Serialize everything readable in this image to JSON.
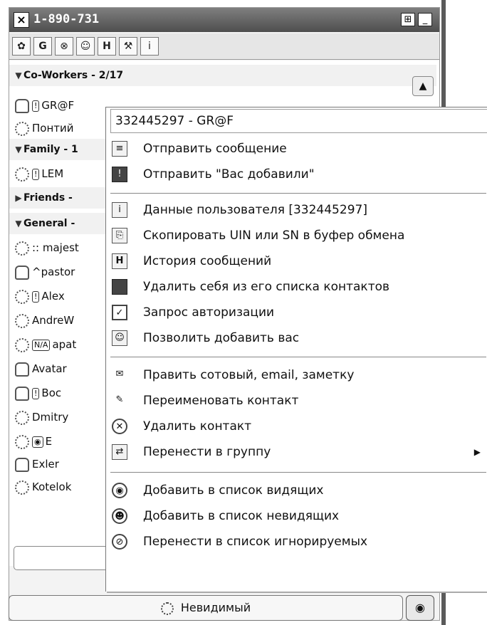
{
  "titlebar": {
    "title": "1-890-731"
  },
  "groups": [
    {
      "label": "Co-Workers - 2/17"
    },
    {
      "label": "Family - 1"
    },
    {
      "label": "Friends -"
    },
    {
      "label": "General -"
    }
  ],
  "contacts": [
    {
      "name": "GR@F"
    },
    {
      "name": "Понтий"
    },
    {
      "name": "LEM"
    },
    {
      "name": ":: majest"
    },
    {
      "name": "^pastor"
    },
    {
      "name": "Alex"
    },
    {
      "name": "AndreW"
    },
    {
      "name": "apat"
    },
    {
      "name": "Avatar"
    },
    {
      "name": "Boc"
    },
    {
      "name": "Dmitry"
    },
    {
      "name": "E"
    },
    {
      "name": "Exler"
    },
    {
      "name": "Kotelok"
    }
  ],
  "menu": {
    "header": "332445297 - GR@F",
    "items": [
      {
        "label": "Отправить сообщение",
        "icon": "message-icon"
      },
      {
        "label": "Отправить \"Вас добавили\"",
        "icon": "added-notice-icon"
      },
      {
        "label": "Данные пользователя [332445297]",
        "icon": "user-info-icon"
      },
      {
        "label": "Скопировать UIN или SN в буфер обмена",
        "icon": "copy-icon"
      },
      {
        "label": "История сообщений",
        "icon": "history-icon"
      },
      {
        "label": "Удалить себя из его списка контактов",
        "icon": "remove-self-icon"
      },
      {
        "label": "Запрос авторизации",
        "icon": "authorization-icon"
      },
      {
        "label": "Позволить добавить вас",
        "icon": "allow-add-icon"
      },
      {
        "label": "Править сотовый, email, заметку",
        "icon": "edit-contact-info-icon"
      },
      {
        "label": "Переименовать контакт",
        "icon": "rename-icon"
      },
      {
        "label": "Удалить контакт",
        "icon": "delete-contact-icon"
      },
      {
        "label": "Перенести в группу",
        "icon": "move-group-icon",
        "submenu": true
      },
      {
        "label": "Добавить в список видящих",
        "icon": "visible-list-icon"
      },
      {
        "label": "Добавить в список невидящих",
        "icon": "invisible-list-icon"
      },
      {
        "label": "Перенести в список игнорируемых",
        "icon": "ignore-list-icon"
      }
    ]
  },
  "status": {
    "label": "Невидимый"
  },
  "icons": {
    "toolbar": [
      "settings-icon",
      "g-icon",
      "ignore-icon",
      "contacts-icon",
      "history-h-icon",
      "tools-icon",
      "info-icon"
    ],
    "header_buttons": [
      "dock-icon",
      "minimize-icon"
    ]
  }
}
